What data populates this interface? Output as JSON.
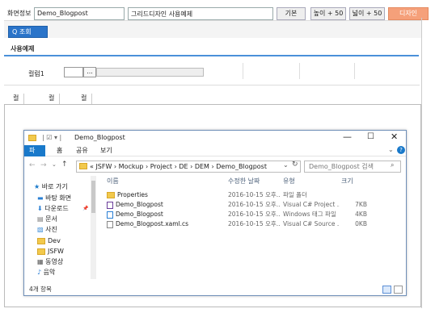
{
  "topbar": {
    "screen_label": "화면정보",
    "screen_value": "Demo_Blogpost",
    "screen_desc": "그리드디자인 사용예제",
    "btn_basic": "기본",
    "btn_height": "높이 + 50",
    "btn_width": "넓이 + 50",
    "btn_design": "디자인"
  },
  "query": {
    "button_label": "Q 조회"
  },
  "section": {
    "title": "사용예제"
  },
  "form": {
    "col1_label": "컬럼1",
    "col1_btn": "..."
  },
  "grid_tabs": [
    "컬럼1",
    "컬럼2",
    "컬럼3"
  ],
  "explorer": {
    "title": "Demo_Blogpost",
    "ribbon_tabs": [
      "파일",
      "홈",
      "공유",
      "보기"
    ],
    "address": "« JSFW › Mockup › Project › DE › DEM › Demo_Blogpost",
    "search_placeholder": "Demo_Blogpost 검색",
    "nav": {
      "quick": "바로 가기",
      "items": [
        "바탕 화면",
        "다운로드",
        "문서",
        "사진",
        "Dev",
        "JSFW",
        "동영상",
        "음악"
      ]
    },
    "columns": [
      "이름",
      "수정한 날짜",
      "유형",
      "크기"
    ],
    "files": [
      {
        "name": "Properties",
        "date": "2016-10-15 오후...",
        "type": "파일 폴더",
        "size": ""
      },
      {
        "name": "Demo_Blogpost",
        "date": "2016-10-15 오후...",
        "type": "Visual C# Project ...",
        "size": "7KB"
      },
      {
        "name": "Demo_Blogpost",
        "date": "2016-10-15 오후...",
        "type": "Windows 태그 파일",
        "size": "4KB"
      },
      {
        "name": "Demo_Blogpost.xaml.cs",
        "date": "2016-10-15 오후...",
        "type": "Visual C# Source ...",
        "size": "0KB"
      }
    ],
    "status": "4개 항목"
  },
  "colors": {
    "accent": "#1979ca",
    "query_btn": "#2a74c9",
    "design_btn": "#f5a07a"
  }
}
